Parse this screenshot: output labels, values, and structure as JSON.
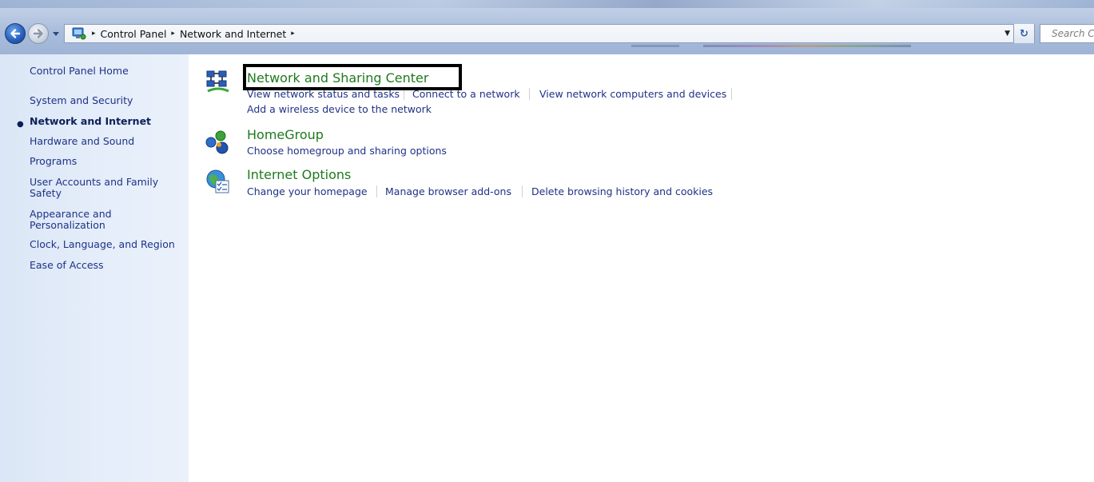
{
  "address_bar": {
    "crumbs": [
      "Control Panel",
      "Network and Internet"
    ],
    "separator": "▸",
    "dropdown": "▼",
    "refresh_icon": "↻"
  },
  "search": {
    "placeholder": "Search C"
  },
  "left_pane": {
    "items": [
      {
        "label": "Control Panel Home"
      },
      {
        "label": "System and Security"
      },
      {
        "label": "Network and Internet",
        "active": true
      },
      {
        "label": "Hardware and Sound"
      },
      {
        "label": "Programs"
      },
      {
        "label": "User Accounts and Family Safety"
      },
      {
        "label": "Appearance and Personalization"
      },
      {
        "label": "Clock, Language, and Region"
      },
      {
        "label": "Ease of Access"
      }
    ],
    "bullet": "●"
  },
  "categories": [
    {
      "title": "Network and Sharing Center",
      "icon": "network-sharing-icon",
      "links": [
        "View network status and tasks",
        "Connect to a network",
        "View network computers and devices",
        "Add a wireless device to the network"
      ]
    },
    {
      "title": "HomeGroup",
      "icon": "homegroup-icon",
      "links": [
        "Choose homegroup and sharing options"
      ]
    },
    {
      "title": "Internet Options",
      "icon": "internet-options-icon",
      "links": [
        "Change your homepage",
        "Manage browser add-ons",
        "Delete browsing history and cookies"
      ]
    }
  ],
  "colors": {
    "link": "#1e3287",
    "category_title": "#1e7a1e",
    "left_pane_bg": "#e4edf9",
    "highlight_border": "#000000"
  }
}
